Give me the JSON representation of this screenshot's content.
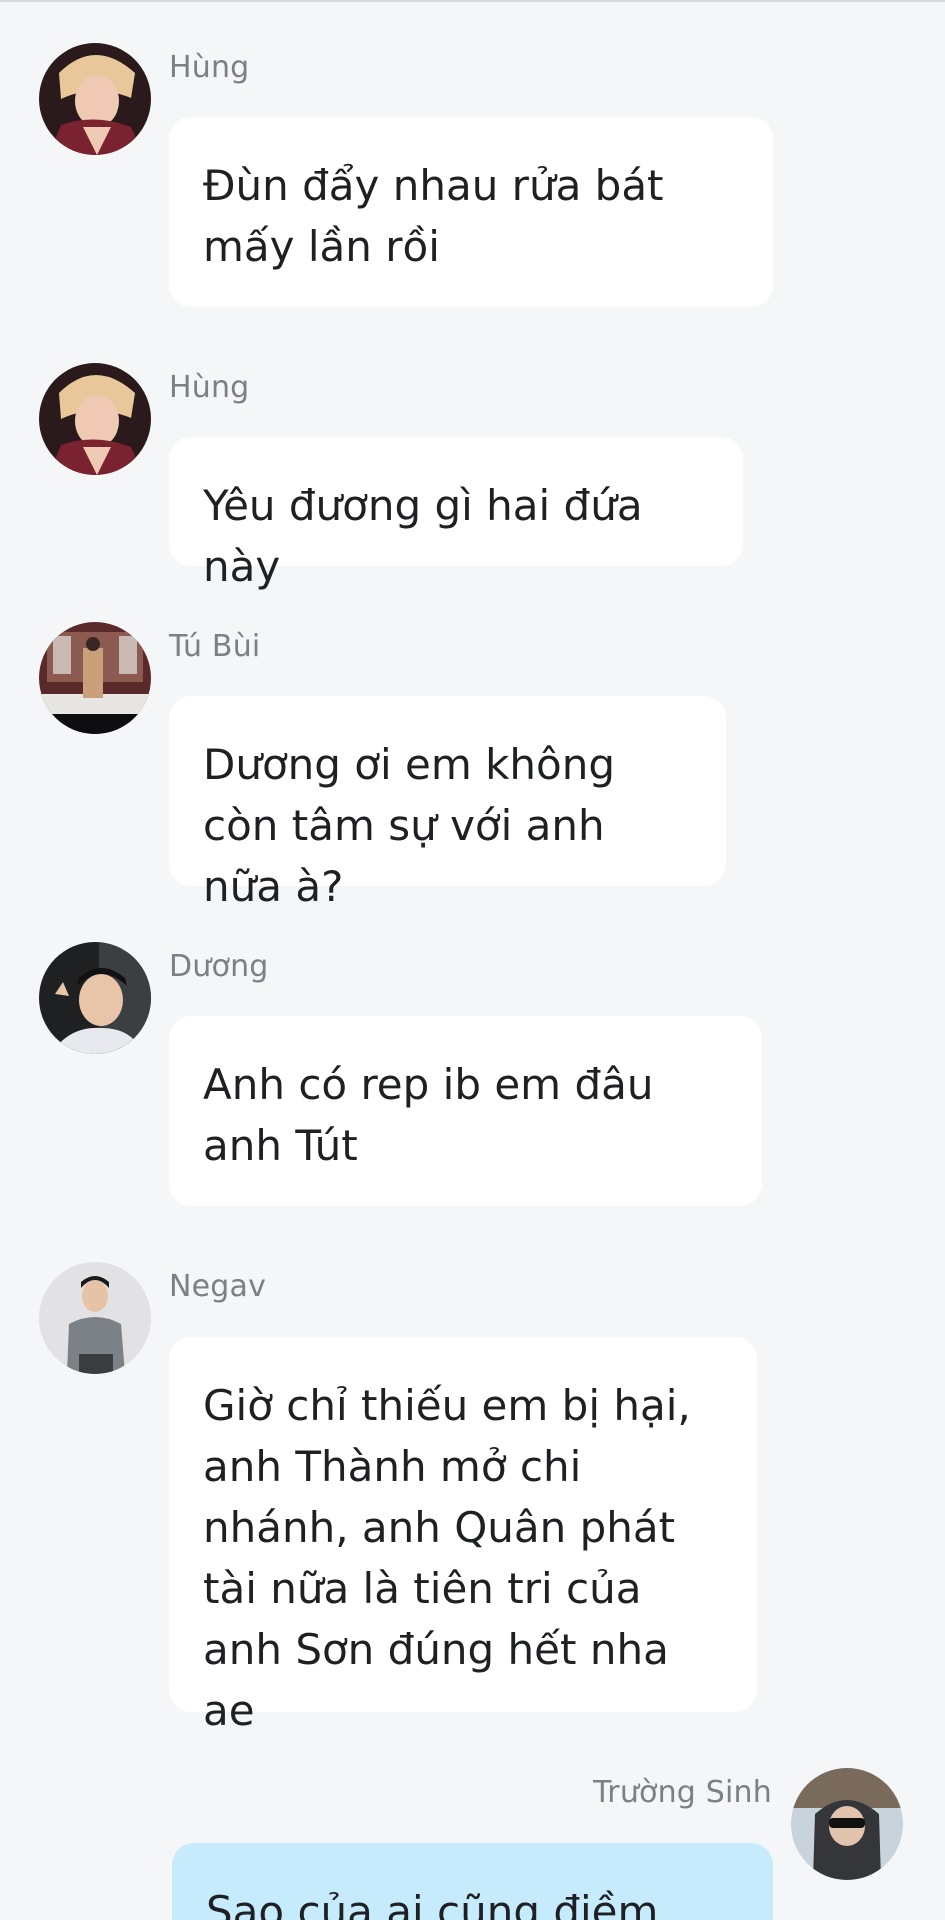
{
  "messages": [
    {
      "sender": "Hùng",
      "text": "Đùn đẩy nhau rửa bát mấy lần rồi",
      "avatar": "hung-avatar"
    },
    {
      "sender": "Hùng",
      "text": "Yêu đương gì hai đứa này",
      "avatar": "hung-avatar"
    },
    {
      "sender": "Tú Bùi",
      "text": "Dương ơi em không còn tâm sự với anh nữa à?",
      "avatar": "tu-bui-avatar"
    },
    {
      "sender": "Dương",
      "text": "Anh có rep ib em đâu anh Tút",
      "avatar": "duong-avatar"
    },
    {
      "sender": "Negav",
      "text": "Giờ chỉ thiếu em bị hại, anh Thành mở chi nhánh, anh Quân phát tài nữa là tiên tri của anh Sơn đúng hết nha ae",
      "avatar": "negav-avatar"
    },
    {
      "sender": "Trường Sinh",
      "text": "Sao của ai cũng điềm lành",
      "avatar": "truong-sinh-avatar",
      "own": true
    }
  ],
  "colors": {
    "background": "#f5f6f8",
    "incoming_bubble": "#ffffff",
    "outgoing_bubble": "#c5ebfd",
    "sender_name": "#7b7f86",
    "message_text": "#1e2024"
  }
}
